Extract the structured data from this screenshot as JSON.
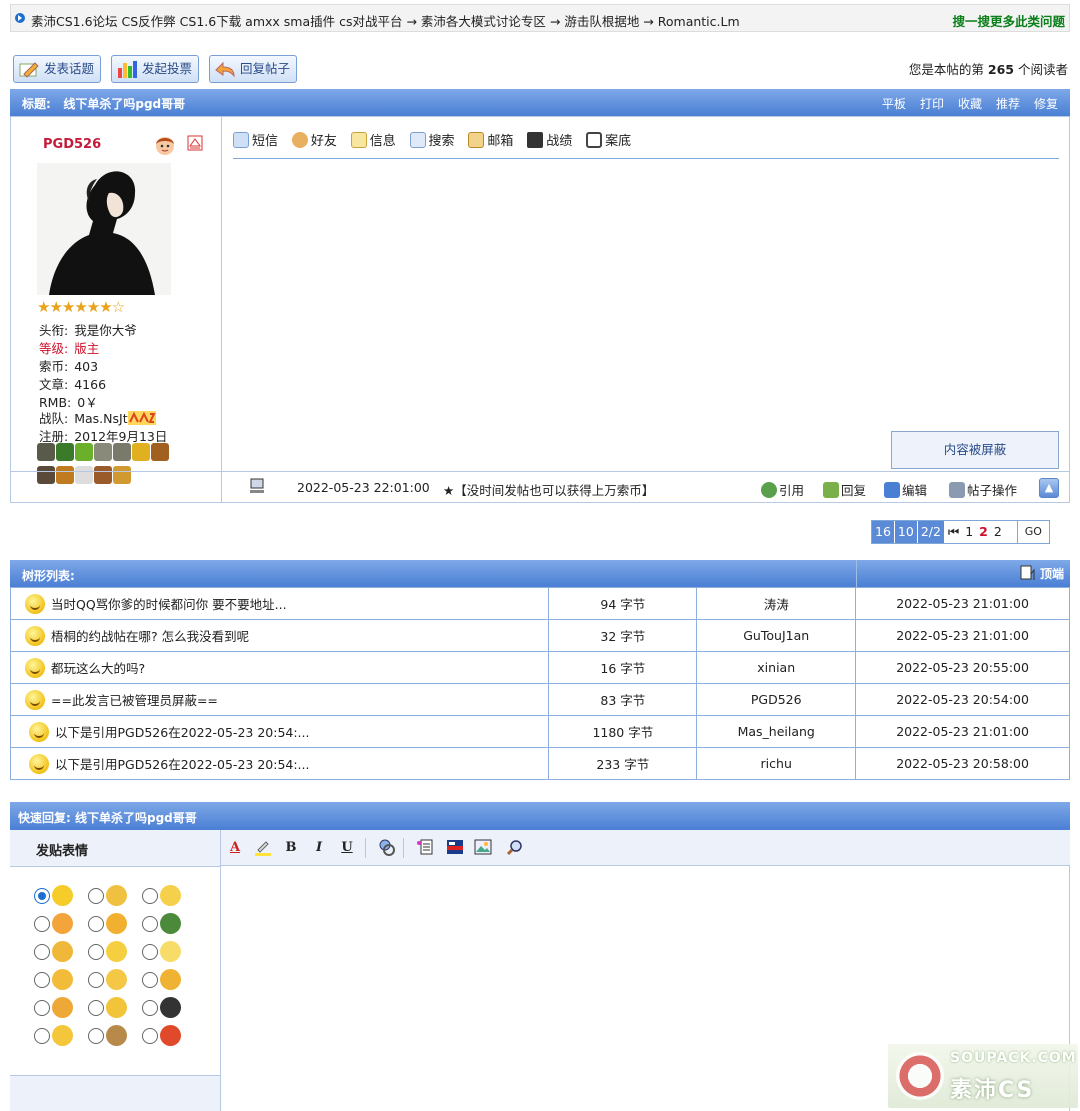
{
  "breadcrumb": "素沛CS1.6论坛 CS反作弊 CS1.6下载 amxx sma插件 cs对战平台 → 素沛各大模式讨论专区 → 游击队根据地 → Romantic.Lm",
  "search_more": "搜一搜更多此类问题",
  "actions": {
    "new_topic": "发表话题",
    "new_poll": "发起投票",
    "reply_post": "回复帖子"
  },
  "readers": {
    "prefix": "您是本帖的第",
    "count": "265",
    "suffix": "个阅读者"
  },
  "post": {
    "title_label": "标题:",
    "title": "线下单杀了吗pgd哥哥",
    "header_links": [
      "平板",
      "打印",
      "收藏",
      "推荐",
      "修复"
    ],
    "user": {
      "name": "PGD526",
      "stars": "★★★★★★☆",
      "fields": [
        {
          "k": "头衔:",
          "v": "我是你大爷"
        },
        {
          "k": "等级:",
          "v": "版主"
        },
        {
          "k": "索币:",
          "v": "403"
        },
        {
          "k": "文章:",
          "v": "4166"
        },
        {
          "k": "RMB:",
          "v": "0￥"
        },
        {
          "k": "战队:",
          "v": "Mas.NsJt"
        },
        {
          "k": "注册:",
          "v": "2012年9月13日"
        }
      ]
    },
    "tools": [
      "短信",
      "好友",
      "信息",
      "搜索",
      "邮箱",
      "战绩",
      "案底"
    ],
    "blocked_text": "内容被屏蔽",
    "date": "2022-05-23 22:01:00",
    "ad": "★【没时间发帖也可以获得上万索币】",
    "foot_actions": [
      "引用",
      "回复",
      "编辑",
      "帖子操作"
    ]
  },
  "pager": {
    "total": "16",
    "per": "10",
    "pages": "2/2",
    "first": "⏮",
    "p1": "1",
    "p2": "2",
    "input": "2",
    "go": "GO"
  },
  "tree": {
    "title": "树形列表:",
    "top_link": "顶端",
    "rows": [
      {
        "title": "当时QQ骂你爹的时候都问你 要不要地址...",
        "size": "94 字节",
        "author": "涛涛",
        "time": "2022-05-23 21:01:00"
      },
      {
        "title": "梧桐的约战帖在哪? 怎么我没看到呢",
        "size": "32 字节",
        "author": "GuTouJ1an",
        "time": "2022-05-23 21:01:00"
      },
      {
        "title": "都玩这么大的吗?",
        "size": "16 字节",
        "author": "xinian",
        "time": "2022-05-23 20:55:00"
      },
      {
        "title": "==此发言已被管理员屏蔽==",
        "size": "83 字节",
        "author": "PGD526",
        "time": "2022-05-23 20:54:00"
      },
      {
        "title": "以下是引用PGD526在2022-05-23 20:54:...",
        "size": "1180 字节",
        "author": "Mas_heilang",
        "time": "2022-05-23 21:01:00"
      },
      {
        "title": "以下是引用PGD526在2022-05-23 20:54:...",
        "size": "233 字节",
        "author": "richu",
        "time": "2022-05-23 20:58:00"
      }
    ]
  },
  "quick_reply": {
    "title": "快速回复: 线下单杀了吗pgd哥哥",
    "emoticon_label": "发贴表情",
    "format_buttons": [
      "B",
      "I",
      "U"
    ]
  },
  "watermark": {
    "line1": "SOUPACK.COM",
    "line2": "素沛CS"
  },
  "colors": {
    "accent": "#4a7fd4",
    "username": "#c41b3a",
    "link_green": "#0a7f1a"
  }
}
